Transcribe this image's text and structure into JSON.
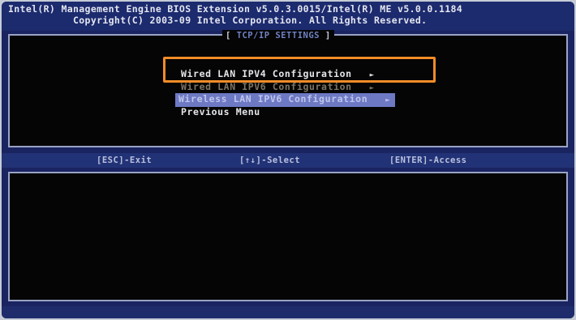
{
  "header": {
    "line1": "Intel(R) Management Engine BIOS Extension v5.0.3.0015/Intel(R) ME v5.0.0.1184",
    "line2": "Copyright(C) 2003-09 Intel Corporation.  All Rights Reserved."
  },
  "panel": {
    "title": "TCP/IP SETTINGS"
  },
  "menu": {
    "items": [
      {
        "label": "Wired LAN IPV4 Configuration",
        "arrow": "►",
        "state": "highlighted-outline"
      },
      {
        "label": "Wired LAN IPV6 Configuration",
        "arrow": "►",
        "state": "obscured"
      },
      {
        "label": "Wireless LAN IPV6 Configuration",
        "arrow": "►",
        "state": "selected"
      },
      {
        "label": "Previous Menu",
        "state": "normal"
      }
    ]
  },
  "keybar": {
    "esc": "[ESC]-Exit",
    "nav": "[↑↓]-Select",
    "enter": "[ENTER]-Access"
  },
  "colors": {
    "frame": "#1a2461",
    "panel": "#050505",
    "highlight_outline": "#f28c28",
    "selection": "#6e79c4"
  }
}
